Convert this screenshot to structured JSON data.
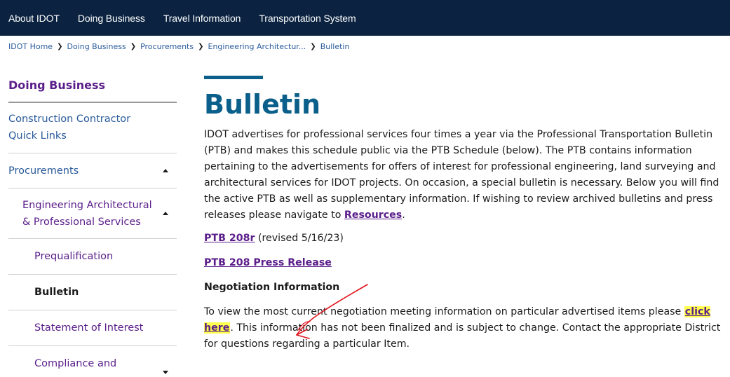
{
  "topnav": {
    "items": [
      "About IDOT",
      "Doing Business",
      "Travel Information",
      "Transportation System"
    ]
  },
  "breadcrumb": {
    "items": [
      "IDOT Home",
      "Doing Business",
      "Procurements",
      "Engineering Architectur...",
      "Bulletin"
    ]
  },
  "sidebar": {
    "heading": "Doing Business",
    "items": [
      "Construction Contractor Quick Links",
      "Procurements",
      "Engineering Architectural & Professional Services",
      "Prequalification",
      "Bulletin",
      "Statement of Interest",
      "Compliance and"
    ]
  },
  "main": {
    "title": "Bulletin",
    "intro_text": "IDOT advertises for professional services four times a year via the Professional Transportation Bulletin (PTB) and makes this schedule public via the PTB Schedule (below). The PTB contains information pertaining to the advertisements for offers of interest for professional engineering, land surveying and architectural services for IDOT projects. On occasion, a special bulletin is necessary. Below you will find the active PTB as well as supplementary information. If wishing to review archived bulletins and press releases please navigate to ",
    "resources_link": "Resources",
    "intro_end": ".",
    "ptb_link": "PTB 208r",
    "ptb_note": " (revised 5/16/23)",
    "press_link": "PTB 208 Press Release",
    "negotiation_heading": "Negotiation Information",
    "negotiation_text_1": "To view the most current negotiation meeting information on particular advertised items please ",
    "click_here": "click here",
    "negotiation_text_2": ". This information has not been finalized and is subject to change. Contact the appropriate District for questions regarding a particular Item."
  },
  "colors": {
    "nav_bg": "#0b2341",
    "title": "#0b5f8b",
    "sidebar_link": "#5a1d8a",
    "highlight": "#ffff4d",
    "annotation": "#e0141e"
  }
}
